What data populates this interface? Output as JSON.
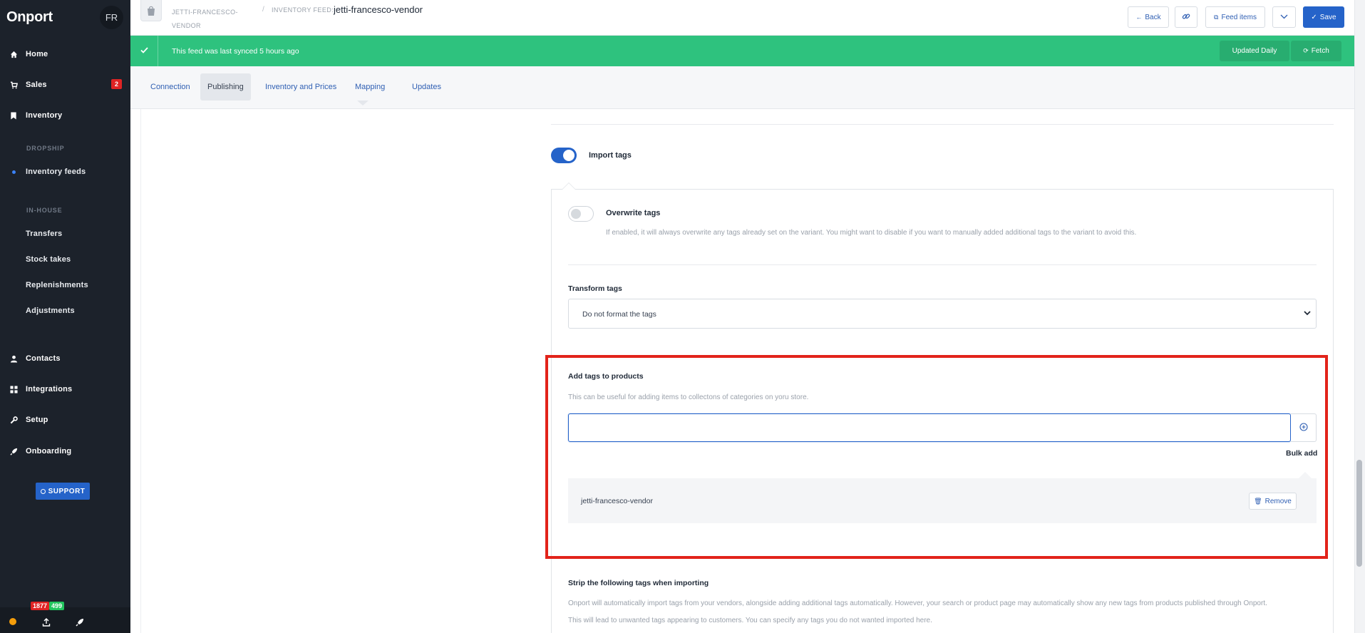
{
  "app": {
    "brand": "Onport",
    "user_initials": "FR"
  },
  "sidebar": {
    "items": [
      {
        "label": "Home",
        "icon": "home-icon"
      },
      {
        "label": "Sales",
        "icon": "cart-icon",
        "badge": "2"
      },
      {
        "label": "Inventory",
        "icon": "bookmark-icon"
      }
    ],
    "dropship_heading": "DROPSHIP",
    "dropship_items": [
      "Inventory feeds"
    ],
    "inhouse_heading": "IN-HOUSE",
    "inhouse_items": [
      "Transfers",
      "Stock takes",
      "Replenishments",
      "Adjustments"
    ],
    "lower_items": [
      {
        "label": "Contacts",
        "icon": "user-icon"
      },
      {
        "label": "Integrations",
        "icon": "grid-icon"
      },
      {
        "label": "Setup",
        "icon": "wrench-icon"
      },
      {
        "label": "Onboarding",
        "icon": "rocket-icon"
      }
    ],
    "support_label": "SUPPORT",
    "counters": {
      "red": "1877",
      "green": "499"
    }
  },
  "header": {
    "vendor_crumb": "JETTI-FRANCESCO-VENDOR",
    "separator": "/",
    "feed_label": "INVENTORY FEED:",
    "feed_value": "jetti-francesco-vendor",
    "back_label": "Back",
    "feed_items_label": "Feed items",
    "save_label": "Save"
  },
  "sync": {
    "message": "This feed was last synced 5 hours ago",
    "frequency_label": "Updated Daily",
    "fetch_label": "Fetch"
  },
  "tabs": [
    "Connection",
    "Publishing",
    "Inventory and Prices",
    "Mapping",
    "Updates"
  ],
  "active_tab": "Publishing",
  "form": {
    "import_tags": {
      "label": "Import tags",
      "enabled": true
    },
    "overwrite_tags": {
      "label": "Overwrite tags",
      "enabled": false,
      "description": "If enabled, it will always overwrite any tags already set on the variant. You might want to disable if you want to manually added additional tags to the variant to avoid this."
    },
    "transform_tags": {
      "label": "Transform tags",
      "selected": "Do not format the tags"
    },
    "add_tags": {
      "label": "Add tags to products",
      "description": "This can be useful for adding items to collectons of categories on yoru store.",
      "input_value": "",
      "bulk_add_label": "Bulk add",
      "tags": [
        {
          "name": "jetti-francesco-vendor",
          "remove_label": "Remove"
        }
      ]
    },
    "strip_tags": {
      "label": "Strip the following tags when importing",
      "description_1": "Onport will automatically import tags from your vendors, alongside adding additional tags automatically. However, your search or product page may automatically show any new tags from products published through Onport.",
      "description_2": "This will lead to unwanted tags appearing to customers. You can specify any tags you do not wanted imported here."
    }
  },
  "colors": {
    "accent": "#2563c9",
    "success": "#2ec27e",
    "sidebar": "#1c222b",
    "highlight": "#e2231a"
  }
}
